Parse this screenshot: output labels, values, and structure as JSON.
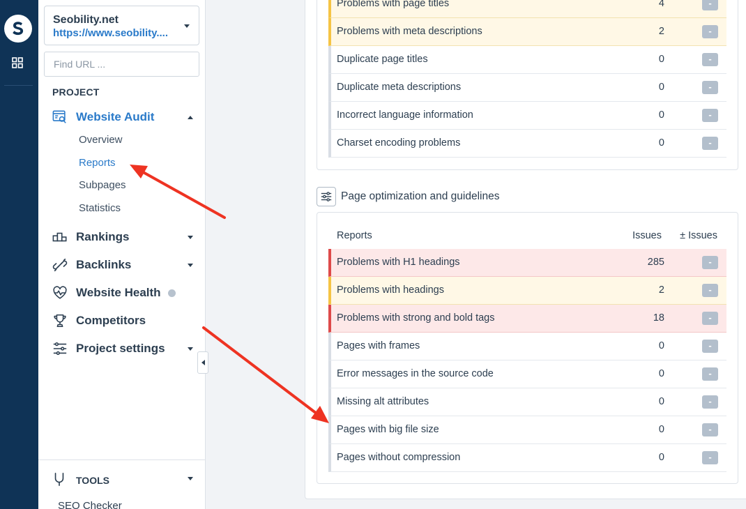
{
  "app": {
    "icons": {
      "logo": "seobility-s-logo",
      "apps": "grid-icon"
    },
    "colors": {
      "rail": "#0f3356",
      "accent": "#2a7ac9",
      "error": "#de4a4a",
      "warning": "#f5c445"
    }
  },
  "sidebar": {
    "project_name": "Seobility.net",
    "project_url": "https://www.seobility....",
    "find_placeholder": "Find URL ...",
    "section_label": "PROJECT",
    "nav": {
      "audit": {
        "label": "Website Audit",
        "icon": "audit-icon"
      },
      "rankings": {
        "label": "Rankings",
        "icon": "rankings-icon"
      },
      "backlinks": {
        "label": "Backlinks",
        "icon": "link-icon"
      },
      "health": {
        "label": "Website Health",
        "icon": "heart-pulse-icon"
      },
      "competitors": {
        "label": "Competitors",
        "icon": "trophy-icon"
      },
      "settings": {
        "label": "Project settings",
        "icon": "sliders-icon"
      }
    },
    "sub_items": [
      "Overview",
      "Reports",
      "Subpages",
      "Statistics"
    ],
    "tools_label": "TOOLS",
    "tools_first_item": "SEO Checker"
  },
  "main": {
    "meta_rows": [
      {
        "name": "Problems with page titles",
        "count": "4",
        "status": "warning",
        "diff": "-"
      },
      {
        "name": "Problems with meta descriptions",
        "count": "2",
        "status": "warning",
        "diff": "-"
      },
      {
        "name": "Duplicate page titles",
        "count": "0",
        "status": "none",
        "diff": "-"
      },
      {
        "name": "Duplicate meta descriptions",
        "count": "0",
        "status": "none",
        "diff": "-"
      },
      {
        "name": "Incorrect language information",
        "count": "0",
        "status": "none",
        "diff": "-"
      },
      {
        "name": "Charset encoding problems",
        "count": "0",
        "status": "none",
        "diff": "-"
      }
    ],
    "page_opt": {
      "title": "Page optimization and guidelines",
      "icon": "sliders-icon",
      "headers": {
        "reports": "Reports",
        "issues": "Issues",
        "diff": "± Issues"
      },
      "rows": [
        {
          "name": "Problems with H1 headings",
          "count": "285",
          "status": "error",
          "diff": "-"
        },
        {
          "name": "Problems with headings",
          "count": "2",
          "status": "warning",
          "diff": "-"
        },
        {
          "name": "Problems with strong and bold tags",
          "count": "18",
          "status": "error",
          "diff": "-"
        },
        {
          "name": "Pages with frames",
          "count": "0",
          "status": "none",
          "diff": "-"
        },
        {
          "name": "Error messages in the source code",
          "count": "0",
          "status": "none",
          "diff": "-"
        },
        {
          "name": "Missing alt attributes",
          "count": "0",
          "status": "none",
          "diff": "-"
        },
        {
          "name": "Pages with big file size",
          "count": "0",
          "status": "none",
          "diff": "-"
        },
        {
          "name": "Pages without compression",
          "count": "0",
          "status": "none",
          "diff": "-"
        }
      ]
    }
  },
  "annotations": {
    "arrow_color": "#ee3322"
  }
}
